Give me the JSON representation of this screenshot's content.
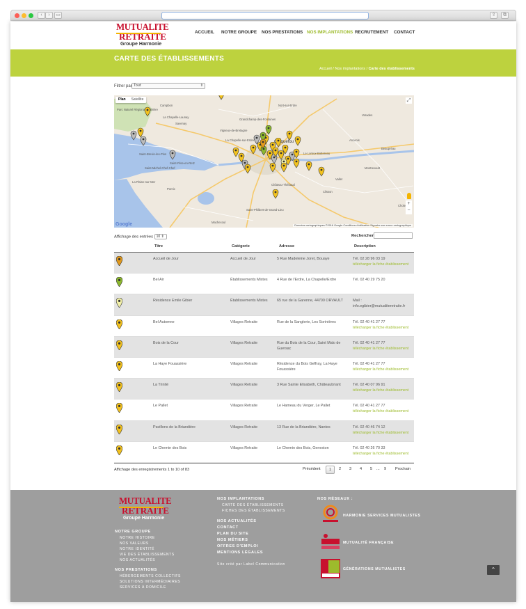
{
  "colors": {
    "accent": "#bdd23e",
    "link": "#9dbb2c",
    "brand_red": "#c8102e",
    "footer_bg": "#9e9e9e"
  },
  "logo": {
    "line1": "MUTUALITE",
    "line2": "RETRAITE",
    "line3": "Groupe Harmonie"
  },
  "nav": {
    "items": [
      "ACCUEIL",
      "NOTRE GROUPE",
      "NOS PRESTATIONS",
      "NOS IMPLANTATIONS",
      "RECRUTEMENT",
      "CONTACT"
    ],
    "active": "NOS IMPLANTATIONS"
  },
  "banner": {
    "title": "CARTE DES ÉTABLISSEMENTS",
    "breadcrumb": [
      "Accueil",
      "Nos implantations",
      "Carte des établissements"
    ],
    "sep": " / "
  },
  "filter": {
    "label": "Filtrer par",
    "value": "Tout"
  },
  "map": {
    "tab_plan": "Plan",
    "tab_satellite": "Satellite",
    "attribution": "Données cartographiques ©2016 Google    Conditions d'utilisation    Signaler une erreur cartographique",
    "google": "Google",
    "places": [
      "Campbon",
      "Parc Naturel Régional de Brière",
      "La Chapelle-Launay",
      "Savenay",
      "Vigneux-de-Bretagne",
      "Grandchamp-des-Fontaines",
      "Nort-sur-Erdre",
      "Carquefou",
      "Saint-Père-en-Retz",
      "Saint-Brevin-les-Pins",
      "Saint-Michel-Chef-Chef",
      "La Plaine-sur-Mer",
      "Pornic",
      "Machecoul",
      "Saint-Philbert-de-Grand-Lieu",
      "Clisson",
      "Vallet",
      "Cholet",
      "Ancenis",
      "Le Loroux-Bottereau",
      "Château-Thébaud",
      "Varades",
      "Montrevault",
      "Beaupréau",
      "La Chapelle-sur-Erdre"
    ]
  },
  "table": {
    "length_label_pre": "Affichage des",
    "length_label_post": "entrées",
    "length_value": "10",
    "search_label": "Rechercher",
    "headers": {
      "title": "Titre",
      "category": "Catégorie",
      "address": "Adresse",
      "description": "Description"
    },
    "download_label": "télécharger la fiche établissement",
    "rows": [
      {
        "pin": "#e39a1c",
        "title": "Accueil de Jour",
        "category": "Accueil de Jour",
        "address": "5 Rue Madeleine Joret, Bouaye",
        "tel": "Tél. 02 28 96 03 19",
        "extra": "télécharger la fiche établissement"
      },
      {
        "pin": "#8db92e",
        "title": "Bel Air",
        "category": "Établissements Mixtes",
        "address": "4 Rue de l'Erdre, La Chapelle/Erdre",
        "tel": "Tél. 02 40 29 75 20",
        "extra": ""
      },
      {
        "pin": "#f2f0a8",
        "title": "Résidence Emile Gibier",
        "category": "Établissements Mixtes",
        "address": "65 rue de la Garenne, 44700 ORVAULT",
        "tel": "Mail :",
        "extra": "info.egibier@mutualiteretraite.fr"
      },
      {
        "pin": "#f3c21e",
        "title": "Bel Automne",
        "category": "Villages Retraite",
        "address": "Rue de la Sanglerie, Les Sorinières",
        "tel": "Tél. 02 40 41 27 77",
        "extra": "télécharger la fiche établissement"
      },
      {
        "pin": "#f3c21e",
        "title": "Bois de la Cour",
        "category": "Villages Retraite",
        "address": "Rue du Bois de la Cour, Saint Malo de Guersac",
        "tel": "Tél. 02 40 41 27 77",
        "extra": "télécharger la fiche établissement"
      },
      {
        "pin": "#f3c21e",
        "title": "La Haye Fouassière",
        "category": "Villages Retraite",
        "address": "Résidence du Bois Geffray, La Haye Fouassière",
        "tel": "Tél. 02 40 41 27 77",
        "extra": "télécharger la fiche établissement"
      },
      {
        "pin": "#f3c21e",
        "title": "La Trinité",
        "category": "Villages Retraite",
        "address": "3 Rue Sainte Elisabeth, Châteaubriant",
        "tel": "Tél. 02 40 07 96 91",
        "extra": "télécharger la fiche établissement"
      },
      {
        "pin": "#f3c21e",
        "title": "Le Pallet",
        "category": "Villages Retraite",
        "address": "Le Hameau du Verger, Le Pallet",
        "tel": "Tél. 02 40 41 27 77",
        "extra": "télécharger la fiche établissement"
      },
      {
        "pin": "#f3c21e",
        "title": "Pavillons de la Briandière",
        "category": "Villages Retraite",
        "address": "13 Rue de la Briandière, Nantes",
        "tel": "Tél. 02 40 46 74 12",
        "extra": "télécharger la fiche établissement"
      },
      {
        "pin": "#f3c21e",
        "title": "Le Chemin des Bois",
        "category": "Villages Retraite",
        "address": "Le Chemin des Bois, Geneston",
        "tel": "Tél. 02 40 26 70 33",
        "extra": "télécharger la fiche établissement"
      }
    ],
    "info": "Affichage des enregistrements 1 to 10 of 83",
    "pager": {
      "prev": "Précédent",
      "pages": [
        "1",
        "2",
        "3",
        "4",
        "5",
        "...",
        "9"
      ],
      "next": "Prochain",
      "current": "1"
    }
  },
  "footer": {
    "logo": {
      "line1": "MUTUALITE",
      "line2": "RETRAITE",
      "line3": "Groupe Harmonie"
    },
    "col1": [
      {
        "head": "NOTRE GROUPE",
        "items": [
          "NOTRE HISTOIRE",
          "NOS VALEURS",
          "NOTRE IDENTITÉ",
          "VIE DES ÉTABLISSEMENTS",
          "NOS ACTUALITÉS"
        ]
      },
      {
        "head": "NOS PRESTATIONS",
        "items": [
          "HÉBERGEMENTS COLLECTIFS",
          "SOLUTIONS INTERMÉDIAIRES",
          "SERVICES À DOMICILE"
        ]
      }
    ],
    "col2": {
      "head": "NOS IMPLANTATIONS",
      "items": [
        "CARTE DES ÉTABLISSEMENTS",
        "FICHES DES ÉTABLISSEMENTS"
      ],
      "links": [
        "NOS ACTUALITÉS",
        "CONTACT",
        "PLAN DU SITE",
        "NOS MÉTIERS",
        "OFFRES D'EMPLOI",
        "MENTIONS LÉGALES"
      ],
      "credit_pre": "Site créé par",
      "credit_name": "Label Communication"
    },
    "col3": {
      "head": "NOS RÉSEAUX :",
      "networks": [
        "HARMONIE SERVICES MUTUALISTES",
        "MUTUALITÉ FRANÇAISE",
        "GÉNÉRATIONS MUTUALISTES"
      ]
    }
  }
}
